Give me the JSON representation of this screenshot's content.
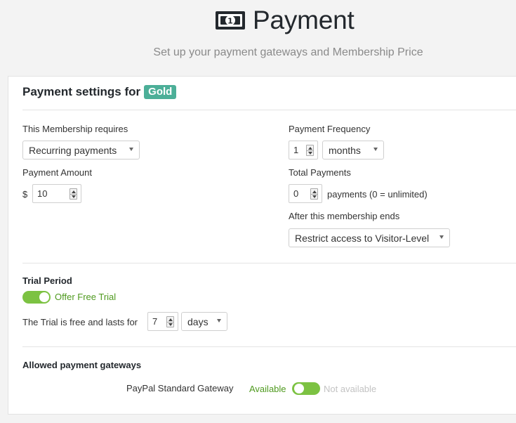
{
  "header": {
    "title": "Payment",
    "subtitle": "Set up your payment gateways and Membership Price",
    "icon": "money-bill-icon"
  },
  "card": {
    "title_prefix": "Payment settings for",
    "membership_badge": "Gold",
    "badge_color": "#4caf98"
  },
  "requires": {
    "label": "This Membership requires",
    "value": "Recurring payments"
  },
  "amount": {
    "label": "Payment Amount",
    "currency": "$",
    "value": "10"
  },
  "frequency": {
    "label": "Payment Frequency",
    "value": "1",
    "unit": "months"
  },
  "total": {
    "label": "Total Payments",
    "value": "0",
    "suffix": "payments (0 = unlimited)"
  },
  "after_end": {
    "label": "After this membership ends",
    "value": "Restrict access to Visitor-Level"
  },
  "trial": {
    "heading": "Trial Period",
    "toggle_label": "Offer Free Trial",
    "toggle_on": true,
    "duration_label": "The Trial is free and lasts for",
    "duration_value": "7",
    "duration_unit": "days"
  },
  "gateways": {
    "heading": "Allowed payment gateways",
    "items": [
      {
        "name": "PayPal Standard Gateway",
        "available_label": "Available",
        "unavailable_label": "Not available",
        "enabled": true
      }
    ]
  },
  "colors": {
    "toggle_on": "#7cc242",
    "available_text": "#4f9a1f",
    "unavailable_text": "#c3c3c3"
  }
}
